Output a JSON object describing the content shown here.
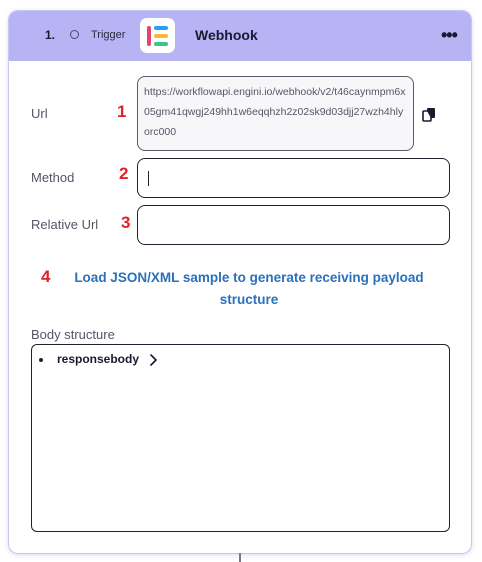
{
  "header": {
    "step_number": "1.",
    "step_type": "Trigger",
    "app_title": "Webhook",
    "status_icon": "radio-circle-icon",
    "app_logo_icon": "webhook-app-logo",
    "more_icon": "more-options-icon"
  },
  "fields": {
    "url": {
      "label": "Url",
      "marker": "1",
      "value": "https://workflowapi.engini.io/webhook/v2/t46caynmpm6x05gm41qwgj249hh1w6eqqhzh2z02sk9d03djj27wzh4hlyorc000",
      "copy_icon": "copy-icon"
    },
    "method": {
      "label": "Method",
      "marker": "2",
      "value": ""
    },
    "relative_url": {
      "label": "Relative Url",
      "marker": "3",
      "value": ""
    }
  },
  "load_sample": {
    "marker": "4",
    "text": "Load JSON/XML sample to generate receiving payload structure"
  },
  "body_structure": {
    "label": "Body structure",
    "items": [
      {
        "label": "responsebody",
        "expand_icon": "chevron-right-icon"
      }
    ]
  },
  "colors": {
    "header_bg": "#b7b4f5",
    "link": "#2c6fba",
    "marker": "#e0202a",
    "logo_bars": [
      "#e8436b",
      "#2a9df4",
      "#f5b93b",
      "#3cc48a"
    ]
  }
}
